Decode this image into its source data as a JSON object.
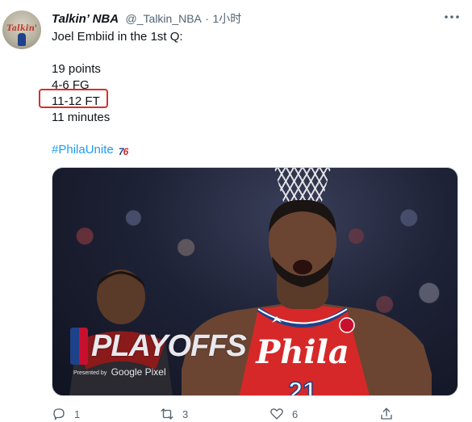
{
  "tweet": {
    "author": {
      "avatar_text": "Talkin'",
      "display_name": "Talkin’ NBA",
      "handle": "@_Talkin_NBA",
      "separator": "·",
      "time": "1小时"
    },
    "lines": [
      "Joel Embiid in the 1st Q:",
      "19 points",
      "4-6 FG",
      "11-12 FT",
      "11 minutes"
    ],
    "hashtag": "#PhilaUnite",
    "hashtag_emoji": {
      "part1": "7",
      "part2": "6"
    },
    "highlighted_line": "11-12 FT",
    "highlight_color": "#d4302b",
    "hashtag_color": "#1d9bf0",
    "media": {
      "jersey_text": "Phila",
      "jersey_number": "21",
      "jersey_color": "#d62828",
      "overlay_title": "PLAYOFFS",
      "overlay_sub_small": "Presented by",
      "overlay_sub": "Google Pixel"
    },
    "actions": {
      "reply_count": "1",
      "retweet_count": "3",
      "like_count": "6",
      "icons": [
        "reply-icon",
        "retweet-icon",
        "like-icon",
        "share-icon"
      ]
    }
  }
}
